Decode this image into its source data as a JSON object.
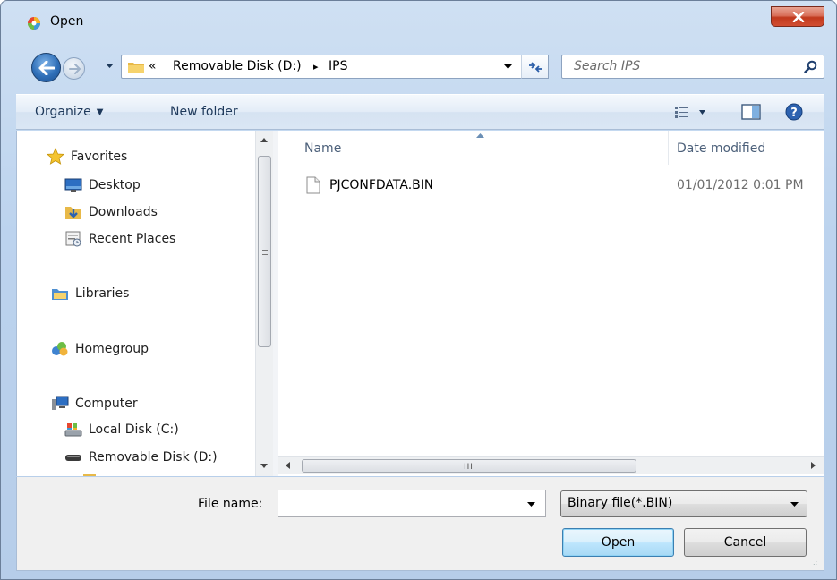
{
  "window": {
    "title": "Open",
    "close_label": "Close"
  },
  "address": {
    "overflow_chevron": "«",
    "crumbs": [
      "Removable Disk (D:)",
      "IPS"
    ],
    "separator": "▸"
  },
  "search": {
    "placeholder": "Search IPS"
  },
  "toolbar": {
    "organize_label": "Organize",
    "new_folder_label": "New folder"
  },
  "nav_pane": {
    "favorites": {
      "label": "Favorites",
      "items": [
        "Desktop",
        "Downloads",
        "Recent Places"
      ]
    },
    "libraries": "Libraries",
    "homegroup": "Homegroup",
    "computer": {
      "label": "Computer",
      "items": [
        "Local Disk (C:)",
        "Removable Disk (D:)"
      ]
    }
  },
  "file_list": {
    "columns": [
      "Name",
      "Date modified"
    ],
    "rows": [
      {
        "name": "PJCONFDATA.BIN",
        "date_modified": "01/01/2012 0:01 PM"
      }
    ]
  },
  "bottom": {
    "file_name_label": "File name:",
    "file_name_value": "",
    "file_type_selected": "Binary file(*.BIN)",
    "open_label": "Open",
    "cancel_label": "Cancel"
  },
  "icons": {
    "app": "app-icon",
    "back": "back-arrow-icon",
    "forward": "forward-arrow-icon",
    "folder": "folder-icon",
    "refresh": "refresh-icon",
    "search": "search-icon",
    "views": "view-options-icon",
    "preview": "preview-pane-icon",
    "help": "help-icon"
  },
  "colors": {
    "window_frame": "#bcd3ee",
    "close_button": "#c0391d",
    "toolbar_text": "#1e395b",
    "open_button": "#bee6fd"
  }
}
